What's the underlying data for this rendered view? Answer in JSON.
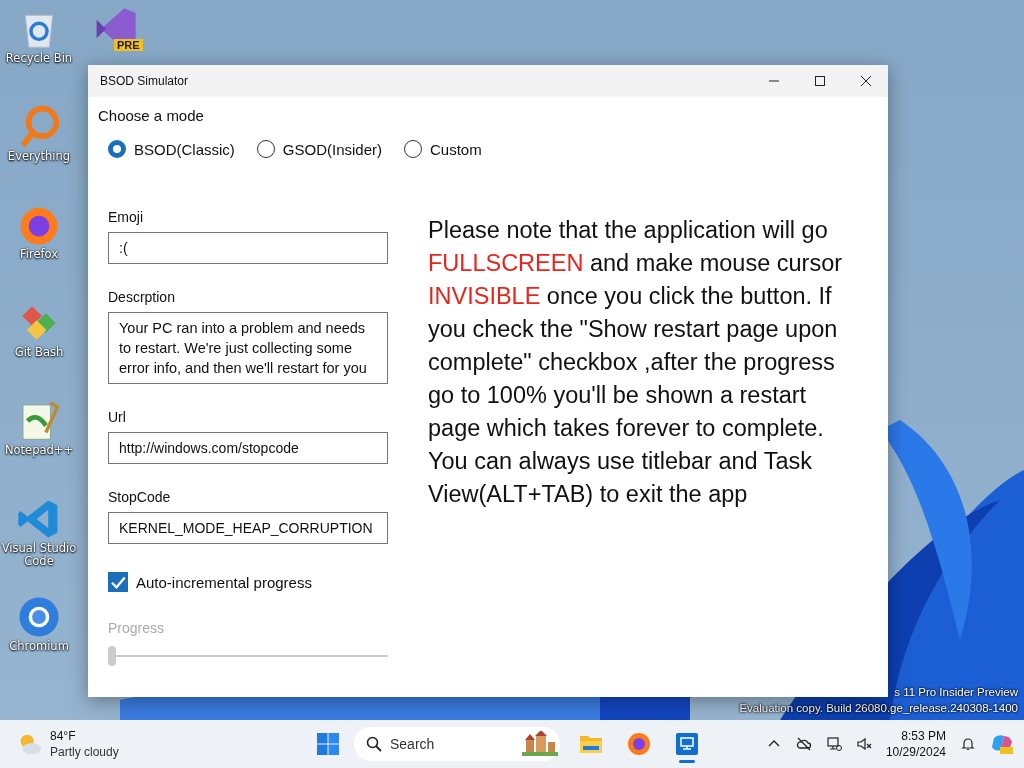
{
  "desktop_icons": [
    {
      "kind": "recycle",
      "label": "Recycle Bin"
    },
    {
      "kind": "everything",
      "label": "Everything"
    },
    {
      "kind": "firefox",
      "label": "Firefox"
    },
    {
      "kind": "gitbash",
      "label": "Git Bash"
    },
    {
      "kind": "notepad",
      "label": "Notepad++"
    },
    {
      "kind": "vscode",
      "label": "Visual Studio Code"
    },
    {
      "kind": "chromium",
      "label": "Chromium"
    }
  ],
  "hidden_icon": {
    "badge": "PRE"
  },
  "watermark": [
    "s 11 Pro Insider Preview",
    "Evaluation copy. Build 26080.ge_release.240308-1400"
  ],
  "window": {
    "title": "BSOD Simulator",
    "mode_label": "Choose a mode",
    "modes": [
      {
        "label": "BSOD(Classic)",
        "selected": true
      },
      {
        "label": "GSOD(Insider)",
        "selected": false
      },
      {
        "label": "Custom",
        "selected": false
      }
    ],
    "fields": [
      {
        "label": "Emoji",
        "value": ":(",
        "kind": "single"
      },
      {
        "label": "Descrption",
        "value": "Your PC ran into a problem and needs to restart. We're just collecting some error info, and then we'll restart for you",
        "kind": "multi"
      },
      {
        "label": "Url",
        "value": "http://windows.com/stopcode",
        "kind": "single"
      },
      {
        "label": "StopCode",
        "value": "KERNEL_MODE_HEAP_CORRUPTION",
        "kind": "single"
      }
    ],
    "checkbox": {
      "label": "Auto-incremental progress",
      "checked": true
    },
    "progress": {
      "label": "Progress",
      "level": 0,
      "disabled": true
    },
    "note": [
      {
        "text": "Please note that the application will go ",
        "highlight": false
      },
      {
        "text": "FULLSCREEN",
        "highlight": true
      },
      {
        "text": " and make mouse cursor ",
        "highlight": false
      },
      {
        "text": "INVISIBLE",
        "highlight": true
      },
      {
        "text": " once you click the button. If you check the \"Show restart page upon complete\" checkbox ,after the progress go to 100% you'll be shown a restart page which takes forever to complete. You can always use titlebar and Task View(ALT+TAB) to exit the app",
        "highlight": false
      }
    ]
  },
  "taskbar": {
    "weather": {
      "temp": "84°F",
      "condition": "Partly cloudy"
    },
    "search": {
      "placeholder": "Search"
    },
    "apps": [
      {
        "kind": "explorer",
        "active": false
      },
      {
        "kind": "firefox",
        "active": false
      },
      {
        "kind": "app",
        "active": true
      }
    ],
    "clock": {
      "time": "8:53 PM",
      "date": "10/29/2024"
    }
  }
}
